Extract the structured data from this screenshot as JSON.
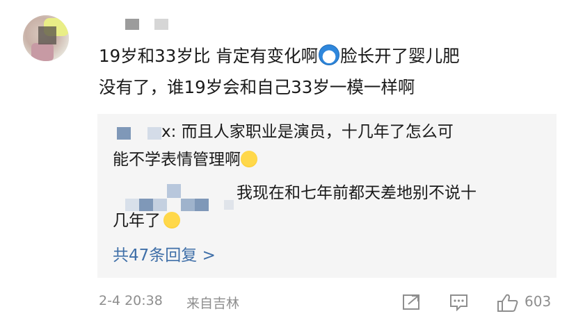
{
  "comment": {
    "line1_before": "19岁和33岁比 肯定有变化啊",
    "line1_after": "脸长开了婴儿肥",
    "line2": "没有了，谁19岁会和自己33岁一模一样啊",
    "emoji": "doraemon-emoji"
  },
  "replies": [
    {
      "author_visible": "x",
      "separator": ": ",
      "text_line1": "而且人家职业是演员，十几年了怎么可",
      "text_line2": "能不学表情管理啊",
      "emoji": "smirk-emoji"
    },
    {
      "text_line1": "我现在和七年前都天差地别不说十",
      "text_line2": "几年了",
      "emoji": "laugh-cry-emoji"
    }
  ],
  "more_replies": "共47条回复 >",
  "footer": {
    "time": "2-4 20:38",
    "location": "来自吉林",
    "like_count": "603",
    "icons": [
      "share-icon",
      "comment-icon",
      "like-icon"
    ]
  },
  "colors": {
    "link": "#3f6fa8",
    "meta": "#8e8e8e",
    "reply_bg": "#f5f5f5"
  }
}
